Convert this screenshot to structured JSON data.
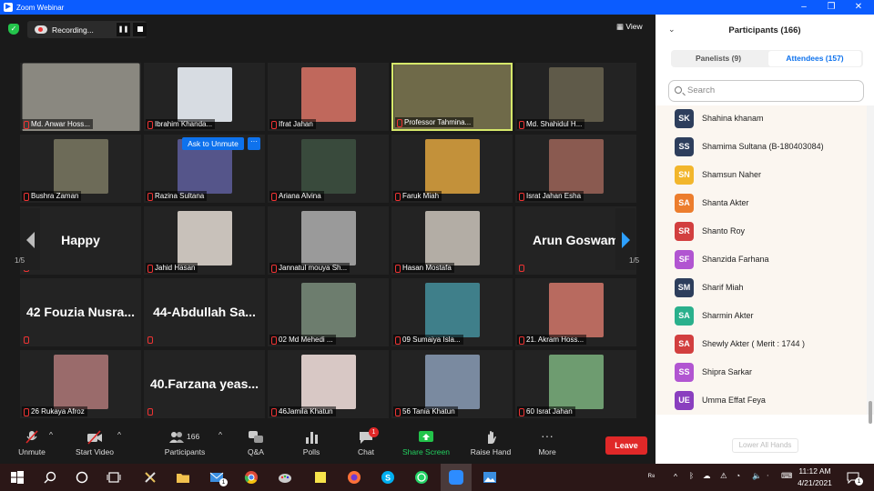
{
  "window": {
    "title": "Zoom Webinar"
  },
  "recording": {
    "label": "Recording...",
    "pause_glyph": "❚❚"
  },
  "view": {
    "label": "View"
  },
  "tiles": [
    {
      "name": "Md. Anwar Hoss...",
      "photo": "#8a8880"
    },
    {
      "name": "Ibrahim Khanda...",
      "photo": "#d7dce2"
    },
    {
      "name": "Ifrat Jahan",
      "photo": "#c0685c"
    },
    {
      "name": "Professor Tahmina...",
      "photo": "#6f6a49"
    },
    {
      "name": "Md. Shahidul H...",
      "photo": "#5f5a49"
    },
    {
      "name": "Bushra Zaman",
      "photo": "#6d6b58"
    },
    {
      "name": "Razina Sultana",
      "photo": "#55558a"
    },
    {
      "name": "Ariana Alvina",
      "photo": "#394a3c"
    },
    {
      "name": "Faruk Miah",
      "photo": "#c3913a"
    },
    {
      "name": "Israt Jahan Esha",
      "photo": "#8a5a50"
    },
    {
      "text": "Happy"
    },
    {
      "name": "Jahid Hasan",
      "photo": "#c8c1ba"
    },
    {
      "name": "Jannatul mouya Sh...",
      "photo": "#9a9a9a"
    },
    {
      "name": "Hasan Mostafa",
      "photo": "#b3ada5"
    },
    {
      "text": "Arun Goswam"
    },
    {
      "text": "42 Fouzia Nusra..."
    },
    {
      "text": "44-Abdullah Sa..."
    },
    {
      "name": "02 Md Mehedi ...",
      "photo": "#6d7d6e"
    },
    {
      "name": "09 Sumaiya Isla...",
      "photo": "#3f7f8a"
    },
    {
      "name": "21. Akram Hoss...",
      "photo": "#b86a5f"
    },
    {
      "name": "26 Rukaya Afroz",
      "photo": "#9a6b6b"
    },
    {
      "text": "40.Farzana yeas..."
    },
    {
      "name": "46Jamila Khatun",
      "photo": "#d8c8c5"
    },
    {
      "name": "56 Tania Khatun",
      "photo": "#7a8aa0"
    },
    {
      "name": "60 Israt Jahan",
      "photo": "#6e9c70"
    }
  ],
  "active_tile_index": 3,
  "pager": {
    "left": "1/5",
    "right": "1/5"
  },
  "ask_unmute": {
    "label": "Ask to Unmute",
    "more": "···"
  },
  "toolbar": {
    "unmute": "Unmute",
    "start_video": "Start Video",
    "participants": "Participants",
    "participants_count": "166",
    "qa": "Q&A",
    "polls": "Polls",
    "chat": "Chat",
    "chat_badge": "1",
    "share_screen": "Share Screen",
    "raise_hand": "Raise Hand",
    "more": "More",
    "leave": "Leave"
  },
  "panel": {
    "title": "Participants (166)",
    "tab_panelists": "Panelists (9)",
    "tab_attendees": "Attendees (157)",
    "search_placeholder": "Search",
    "lower_all_hands": "Lower All Hands"
  },
  "attendees": [
    {
      "initials": "SK",
      "name": "Shahina khanam",
      "color": "#2d3e5c"
    },
    {
      "initials": "SS",
      "name": "Shamima Sultana (B-180403084)",
      "color": "#2d3e5c"
    },
    {
      "initials": "SN",
      "name": "Shamsun Naher",
      "color": "#f2b62c"
    },
    {
      "initials": "SA",
      "name": "Shanta Akter",
      "color": "#ec7d2d"
    },
    {
      "initials": "SR",
      "name": "Shanto Roy",
      "color": "#d23f3f"
    },
    {
      "initials": "SF",
      "name": "Shanzida Farhana",
      "color": "#b155d1"
    },
    {
      "initials": "SM",
      "name": "Sharif Miah",
      "color": "#2d3e5c"
    },
    {
      "initials": "SA",
      "name": "Sharmin Akter",
      "color": "#2ab08c"
    },
    {
      "initials": "SA",
      "name": "Shewly Akter ( Merit : 1744 )",
      "color": "#d23f3f"
    },
    {
      "initials": "SS",
      "name": "Shipra Sarkar",
      "color": "#b155d1"
    },
    {
      "initials": "UE",
      "name": "Umma Effat Feya",
      "color": "#8a3fbf"
    }
  ],
  "taskbar": {
    "time": "11:12 AM",
    "date": "4/21/2021",
    "notify_count": "1",
    "mail_count": "1"
  },
  "colors": {
    "accent": "#0b5cff",
    "leave": "#e02828",
    "active_border": "#d6e86a"
  }
}
